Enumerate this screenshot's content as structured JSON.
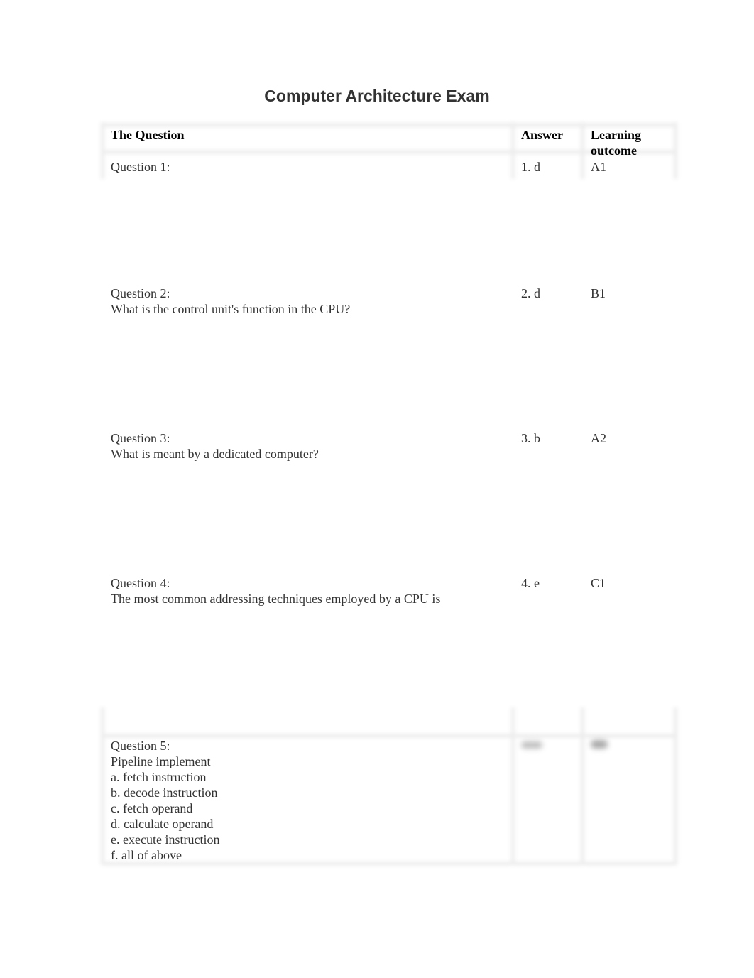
{
  "document": {
    "title": "Computer Architecture Exam"
  },
  "table": {
    "headers": {
      "question": "The Question",
      "answer": "Answer",
      "learning_outcome": "Learning outcome"
    },
    "rows": [
      {
        "label": "Question 1:",
        "text": "",
        "answer": "1. d",
        "outcome": "A1"
      },
      {
        "label": "Question 2:",
        "text": "What is the control unit's function in the CPU?",
        "answer": "2. d",
        "outcome": "B1"
      },
      {
        "label": "Question 3:",
        "text": "What is meant by a dedicated computer?",
        "answer": "3. b",
        "outcome": "A2"
      },
      {
        "label": "Question 4:",
        "text": "The most common addressing techniques employed by a CPU is",
        "answer": "4. e",
        "outcome": "C1"
      },
      {
        "label": "Question 5:",
        "text": "Pipeline implement\na. fetch instruction\nb. decode instruction\nc. fetch operand\nd. calculate operand\ne. execute instruction\nf. all of above",
        "answer": "",
        "outcome": ""
      }
    ]
  }
}
